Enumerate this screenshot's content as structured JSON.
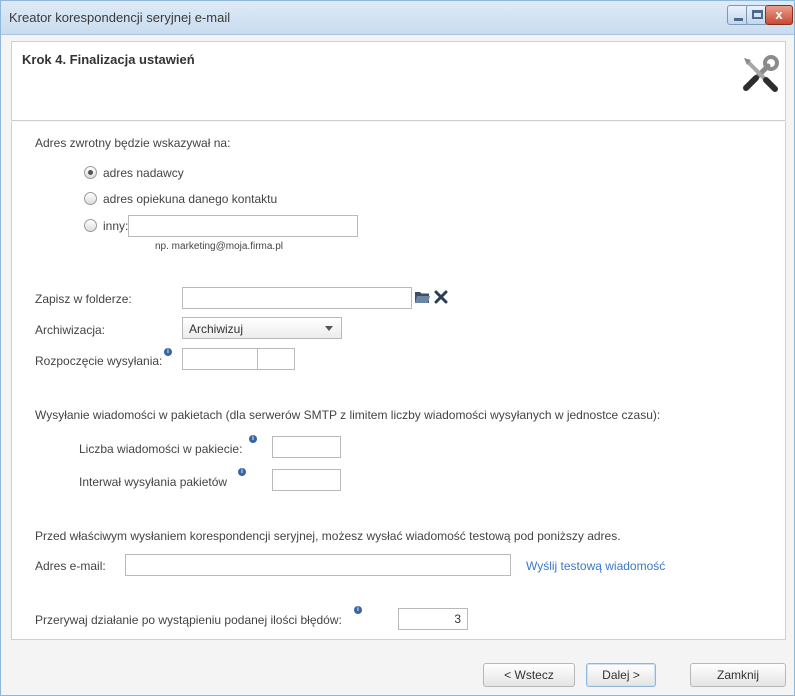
{
  "window": {
    "title": "Kreator korespondencji seryjnej e-mail",
    "controls": [
      "minimize-icon",
      "maximize-icon",
      "close-icon"
    ],
    "close_glyph": "x"
  },
  "header": {
    "step_title": "Krok 4. Finalizacja ustawień",
    "icon": "tools-icon"
  },
  "reply_address": {
    "label": "Adres zwrotny będzie wskazywał na:",
    "options": [
      {
        "label": "adres nadawcy",
        "checked": true
      },
      {
        "label": "adres opiekuna danego kontaktu",
        "checked": false
      },
      {
        "label": "inny:",
        "checked": false
      }
    ],
    "other_value": "",
    "hint": "np. marketing@moja.firma.pl"
  },
  "save_folder": {
    "label": "Zapisz w folderze:",
    "value": "",
    "browse_icon": "folder-icon",
    "clear_icon": "x-icon"
  },
  "archive": {
    "label": "Archiwizacja:",
    "selected": "Archiwizuj"
  },
  "start_sending": {
    "label": "Rozpoczęcie wysyłania:",
    "date_value": "",
    "time_value": ""
  },
  "batches": {
    "label": "Wysyłanie wiadomości w pakietach (dla serwerów SMTP z limitem liczby wiadomości wysyłanych w jednostce czasu):",
    "count_label": "Liczba wiadomości w pakiecie:",
    "count_value": "",
    "interval_label": "Interwał wysyłania pakietów",
    "interval_value": ""
  },
  "test": {
    "description": "Przed właściwym wysłaniem korespondencji seryjnej, możesz wysłać wiadomość testową pod poniższy adres.",
    "email_label": "Adres e-mail:",
    "email_value": "",
    "send_link": "Wyślij testową wiadomość"
  },
  "errors": {
    "label": "Przerywaj działanie po wystąpieniu podanej ilości błędów:",
    "value": "3"
  },
  "footer": {
    "back_label": "< Wstecz",
    "next_label": "Dalej >",
    "close_label": "Zamknij"
  },
  "colors": {
    "accent": "#3a78c3",
    "info_icon": "#3a64a8",
    "close_button": "#c84a33"
  }
}
